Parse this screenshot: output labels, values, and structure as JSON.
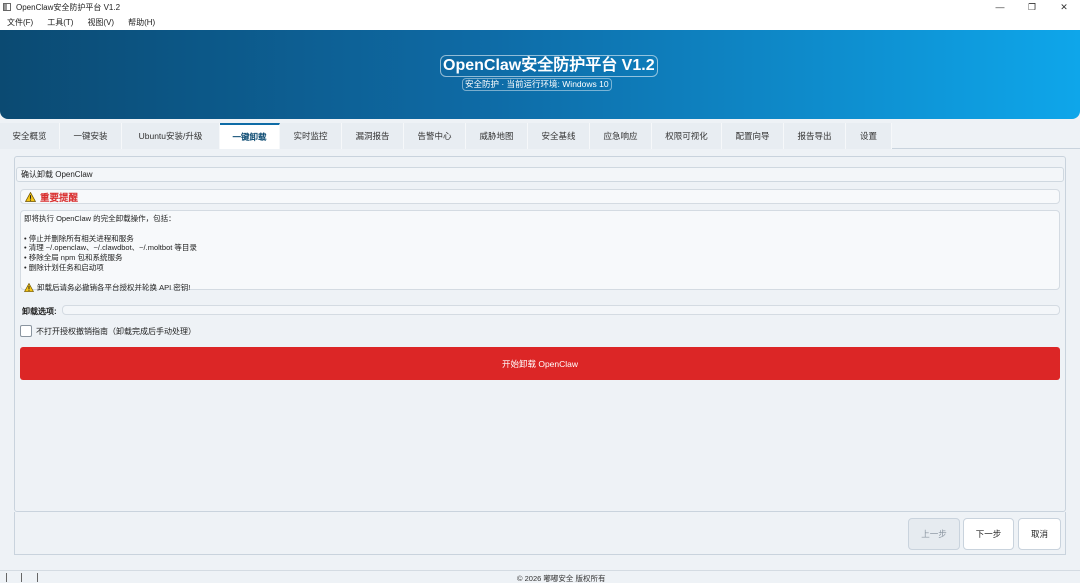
{
  "window": {
    "title": "OpenClaw安全防护平台 V1.2",
    "controls": {
      "minimize": "—",
      "restore": "❐",
      "close": "✕"
    }
  },
  "menu": [
    "文件(F)",
    "工具(T)",
    "视图(V)",
    "帮助(H)"
  ],
  "banner": {
    "title": "OpenClaw安全防护平台 V1.2",
    "subtitle": "安全防护 · 当前运行环境: Windows 10"
  },
  "tabs": [
    "安全概览",
    "一键安装",
    "Ubuntu安装/升级",
    "一键卸载",
    "实时监控",
    "漏洞报告",
    "告警中心",
    "威胁地图",
    "安全基线",
    "应急响应",
    "权限可视化",
    "配置向导",
    "报告导出",
    "设置"
  ],
  "active_tab": "一键卸载",
  "content": {
    "confirm_title": "确认卸载 OpenClaw",
    "warning_title": "重要提醒",
    "intro": "即将执行 OpenClaw 的完全卸载操作，包括：",
    "bullets": [
      "• 停止并删除所有相关进程和服务",
      "• 清理 ~/.openclaw、~/.clawdbot、~/.moltbot 等目录",
      "• 移除全局 npm 包和系统服务",
      "• 删除计划任务和启动项"
    ],
    "note": "卸载后请务必撤销各平台授权并轮换 API 密钥!",
    "options_label": "卸载选项:",
    "checkbox_label": "不打开授权撤销指南（卸载完成后手动处理）",
    "checkbox_checked": false,
    "primary_button": "开始卸载 OpenClaw"
  },
  "nav": {
    "prev": "上一步",
    "next": "下一步",
    "cancel": "取消"
  },
  "status": {
    "copyright": "© 2026 嘟嘟安全 版权所有"
  },
  "colors": {
    "banner_start": "#0b4a72",
    "banner_end": "#0ea6ea",
    "danger": "#dc2626",
    "warning_text": "#d93030"
  },
  "icons": {
    "warning": "warning-icon",
    "app": "app-icon"
  }
}
